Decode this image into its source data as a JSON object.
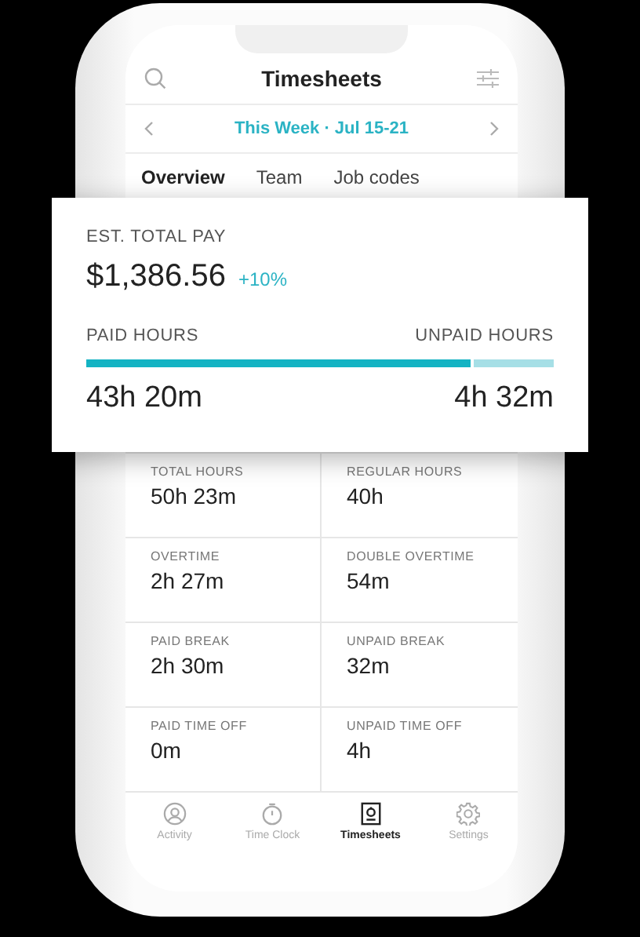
{
  "header": {
    "title": "Timesheets"
  },
  "period": {
    "label": "This Week · Jul 15-21"
  },
  "tabs": [
    {
      "label": "Overview",
      "selected": true
    },
    {
      "label": "Team",
      "selected": false
    },
    {
      "label": "Job codes",
      "selected": false
    }
  ],
  "pay_card": {
    "label": "EST. TOTAL PAY",
    "amount": "$1,386.56",
    "change": "+10%",
    "paid_label": "PAID HOURS",
    "unpaid_label": "UNPAID HOURS",
    "level": 0.83,
    "paid_value": "43h 20m",
    "unpaid_value": "4h 32m"
  },
  "stats": [
    {
      "label": "TOTAL HOURS",
      "value": "50h 23m"
    },
    {
      "label": "REGULAR HOURS",
      "value": "40h"
    },
    {
      "label": "OVERTIME",
      "value": "2h 27m"
    },
    {
      "label": "DOUBLE OVERTIME",
      "value": "54m"
    },
    {
      "label": "PAID BREAK",
      "value": "2h 30m"
    },
    {
      "label": "UNPAID BREAK",
      "value": "32m"
    },
    {
      "label": "PAID TIME OFF",
      "value": "0m"
    },
    {
      "label": "UNPAID TIME OFF",
      "value": "4h"
    }
  ],
  "nav": [
    {
      "label": "Activity",
      "kind": "activity",
      "selected": false
    },
    {
      "label": "Time Clock",
      "kind": "clock",
      "selected": false
    },
    {
      "label": "Timesheets",
      "kind": "timesheets",
      "selected": true
    },
    {
      "label": "Settings",
      "kind": "settings",
      "selected": false
    }
  ]
}
